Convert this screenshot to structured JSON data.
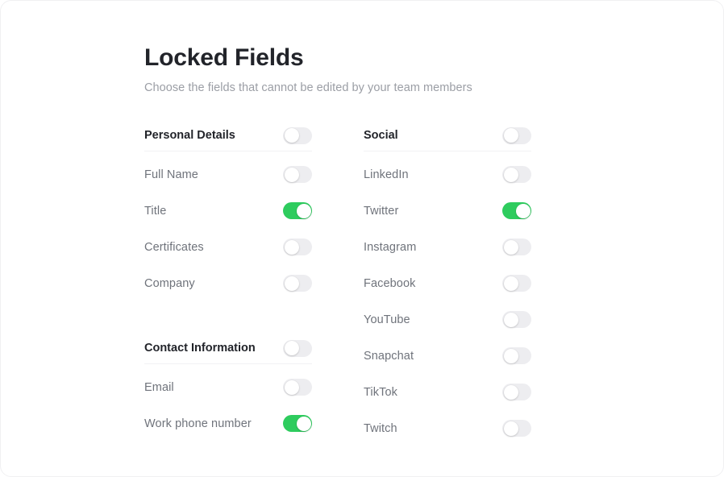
{
  "page": {
    "title": "Locked Fields",
    "subtitle": "Choose the fields that cannot be edited by your team members"
  },
  "colors": {
    "toggle_on": "#2ecc5e",
    "toggle_off": "#ededf0",
    "knob": "#ffffff",
    "title": "#22242a",
    "subtitle": "#9b9ea5",
    "label": "#6f737b",
    "divider": "#f1f1f4"
  },
  "columns": [
    {
      "name": "left",
      "groups": [
        {
          "header": {
            "label": "Personal Details",
            "toggle": "off"
          },
          "rows": [
            {
              "label": "Full Name",
              "toggle": "off"
            },
            {
              "label": "Title",
              "toggle": "on"
            },
            {
              "label": "Certificates",
              "toggle": "off"
            },
            {
              "label": "Company",
              "toggle": "off"
            }
          ]
        },
        {
          "header": {
            "label": "Contact Information",
            "toggle": "off"
          },
          "rows": [
            {
              "label": "Email",
              "toggle": "off"
            },
            {
              "label": "Work phone number",
              "toggle": "on"
            }
          ]
        }
      ]
    },
    {
      "name": "right",
      "groups": [
        {
          "header": {
            "label": "Social",
            "toggle": "off"
          },
          "rows": [
            {
              "label": "LinkedIn",
              "toggle": "off"
            },
            {
              "label": "Twitter",
              "toggle": "on"
            },
            {
              "label": "Instagram",
              "toggle": "off"
            },
            {
              "label": "Facebook",
              "toggle": "off"
            },
            {
              "label": "YouTube",
              "toggle": "off"
            },
            {
              "label": "Snapchat",
              "toggle": "off"
            },
            {
              "label": "TikTok",
              "toggle": "off"
            },
            {
              "label": "Twitch",
              "toggle": "off"
            }
          ]
        }
      ]
    }
  ]
}
